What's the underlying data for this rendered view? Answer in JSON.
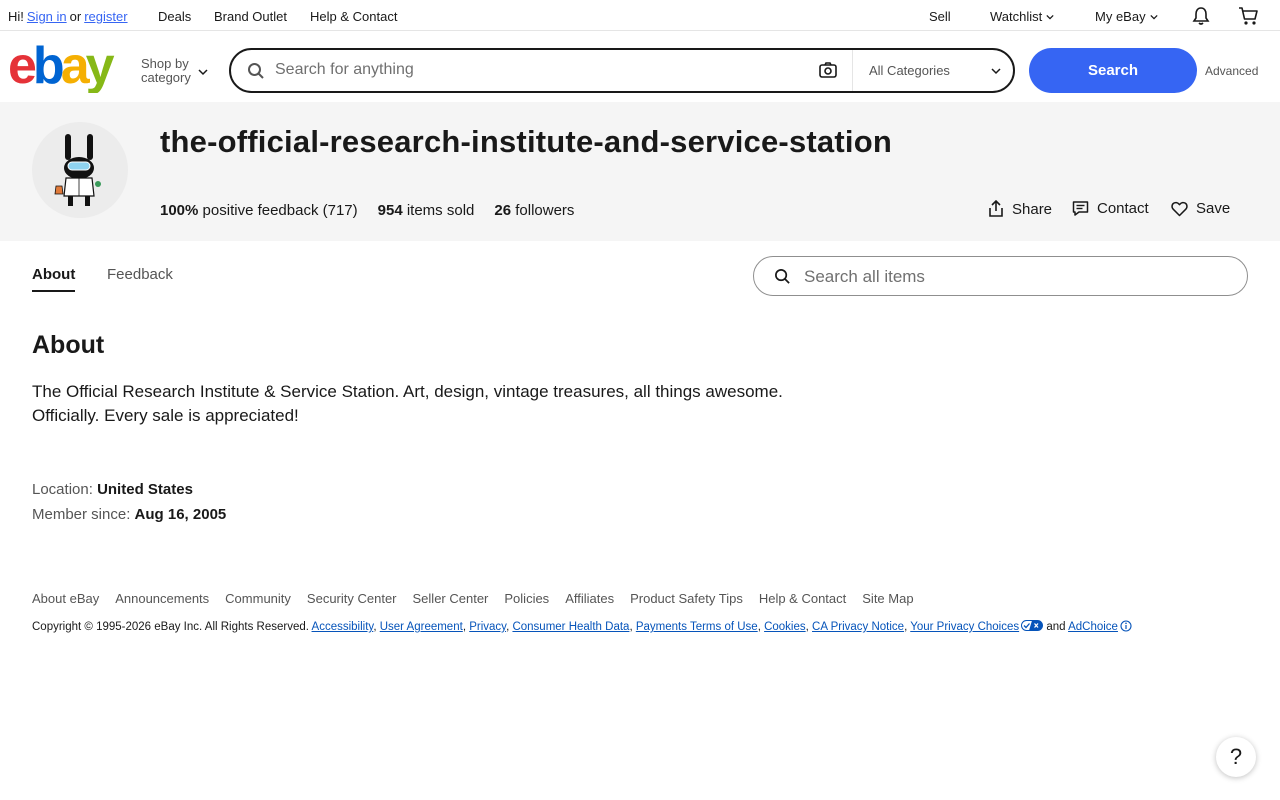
{
  "topbar": {
    "greeting": "Hi!",
    "sign_in": "Sign in",
    "or": "or",
    "register": "register",
    "deals": "Deals",
    "brand_outlet": "Brand Outlet",
    "help_contact": "Help & Contact",
    "sell": "Sell",
    "watchlist": "Watchlist",
    "my_ebay": "My eBay"
  },
  "header": {
    "shop_by_line1": "Shop by",
    "shop_by_line2": "category",
    "search_placeholder": "Search for anything",
    "category_select": "All Categories",
    "search_button": "Search",
    "advanced": "Advanced"
  },
  "store": {
    "name": "the-official-research-institute-and-service-station",
    "feedback_percent": "100%",
    "feedback_label": "positive feedback (717)",
    "items_sold_count": "954",
    "items_sold_label": "items sold",
    "followers_count": "26",
    "followers_label": "followers",
    "share": "Share",
    "contact": "Contact",
    "save": "Save"
  },
  "tabs": {
    "about": "About",
    "feedback": "Feedback",
    "search_placeholder": "Search all items"
  },
  "about": {
    "title": "About",
    "description_line1": "The Official Research Institute & Service Station. Art, design, vintage treasures, all things awesome.",
    "description_line2": "Officially. Every sale is appreciated!",
    "location_label": "Location:",
    "location_value": "United States",
    "member_label": "Member since:",
    "member_value": "Aug 16, 2005"
  },
  "footer": {
    "links": [
      "About eBay",
      "Announcements",
      "Community",
      "Security Center",
      "Seller Center",
      "Policies",
      "Affiliates",
      "Product Safety Tips",
      "Help & Contact",
      "Site Map"
    ],
    "copyright_prefix": "Copyright © 1995-2026 eBay Inc. All Rights Reserved.",
    "legal_links": [
      "Accessibility",
      "User Agreement",
      "Privacy",
      "Consumer Health Data",
      "Payments Terms of Use",
      "Cookies",
      "CA Privacy Notice",
      "Your Privacy Choices"
    ],
    "and": "and",
    "adchoice": "AdChoice"
  },
  "help_button": "?",
  "colors": {
    "brand_blue": "#3665f3",
    "banner_bg": "#f5f5f5",
    "link_blue": "#0654ba"
  }
}
